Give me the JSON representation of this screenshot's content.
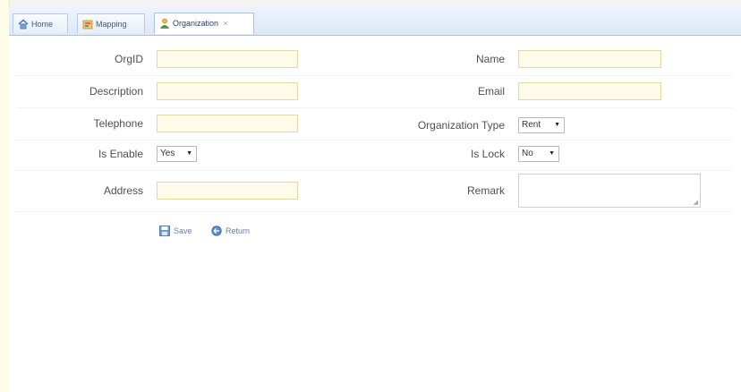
{
  "tabs": [
    {
      "label": "Home",
      "icon": "home-icon"
    },
    {
      "label": "Mapping",
      "icon": "mapping-icon"
    },
    {
      "label": "Organization",
      "icon": "organization-icon",
      "active": true
    }
  ],
  "tab_close_glyph": "×",
  "form": {
    "orgid": {
      "label": "OrgID",
      "value": ""
    },
    "description": {
      "label": "Description",
      "value": ""
    },
    "telephone": {
      "label": "Telephone",
      "value": ""
    },
    "is_enable": {
      "label": "Is Enable",
      "selected": "Yes"
    },
    "address": {
      "label": "Address",
      "value": ""
    },
    "name": {
      "label": "Name",
      "value": ""
    },
    "email": {
      "label": "Email",
      "value": ""
    },
    "organization_type": {
      "label": "Organization Type",
      "selected": "Rent"
    },
    "is_lock": {
      "label": "Is Lock",
      "selected": "No"
    },
    "remark": {
      "label": "Remark",
      "value": ""
    }
  },
  "actions": {
    "save_label": "Save",
    "return_label": "Return"
  },
  "colors": {
    "tab_border": "#a9c1e4",
    "input_bg": "#fffbe9",
    "input_border": "#e3d7a6",
    "link": "#6a7fa8"
  }
}
